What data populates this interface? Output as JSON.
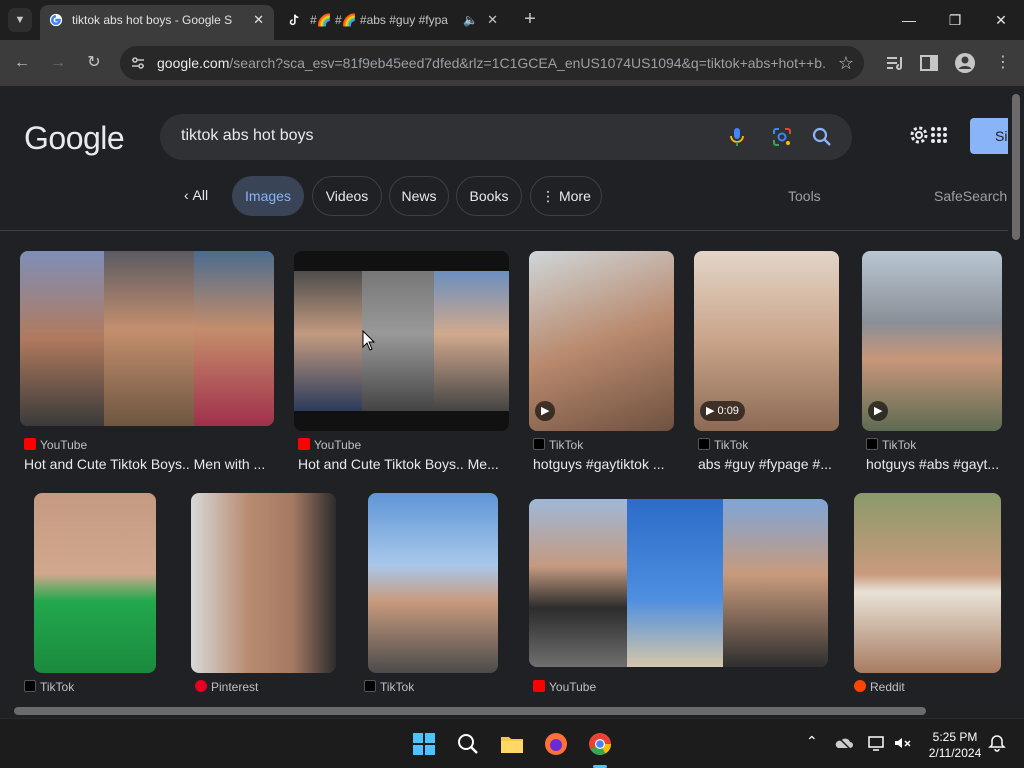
{
  "browser": {
    "tabs": [
      {
        "title": "tiktok abs hot boys - Google Se",
        "favicon": "google-g-icon",
        "active": true
      },
      {
        "title": "#🌈 #🌈 #abs #guy #fypa",
        "favicon": "tiktok-icon",
        "active": false,
        "audio": true
      }
    ],
    "new_tab": "+",
    "url_host": "google.com",
    "url_rest": "/search?sca_esv=81f9eb45eed7dfed&rlz=1C1GCEA_enUS1074US1094&q=tiktok+abs+hot++b..."
  },
  "google": {
    "logo_text": "Google",
    "query": "tiktok abs hot  boys",
    "signin_label": "Si",
    "chips": {
      "all": "All",
      "images": "Images",
      "videos": "Videos",
      "news": "News",
      "books": "Books",
      "more": "More"
    },
    "tools": "Tools",
    "safesearch": "SafeSearch"
  },
  "results": [
    {
      "source": "YouTube",
      "caption": "Hot and Cute Tiktok Boys.. Men with ...",
      "src_color": "#ff0000"
    },
    {
      "source": "YouTube",
      "caption": "Hot and Cute Tiktok Boys.. Me...",
      "src_color": "#ff0000"
    },
    {
      "source": "TikTok",
      "caption": "hotguys #gaytiktok ...",
      "src_color": "#000000"
    },
    {
      "source": "TikTok",
      "caption": "abs #guy #fypage #...",
      "src_color": "#000000",
      "duration": "0:09"
    },
    {
      "source": "TikTok",
      "caption": "hotguys #abs #gayt...",
      "src_color": "#000000"
    },
    {
      "source": "TikTok",
      "caption": "",
      "src_color": "#000000"
    },
    {
      "source": "Pinterest",
      "caption": "",
      "src_color": "#e60023"
    },
    {
      "source": "TikTok",
      "caption": "",
      "src_color": "#000000"
    },
    {
      "source": "YouTube",
      "caption": "",
      "src_color": "#ff0000"
    },
    {
      "source": "Reddit",
      "caption": "",
      "src_color": "#ff4500"
    }
  ],
  "taskbar": {
    "time": "5:25 PM",
    "date": "2/11/2024"
  }
}
